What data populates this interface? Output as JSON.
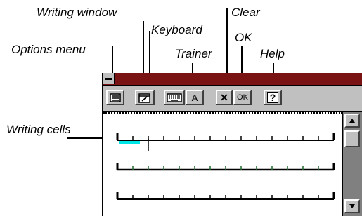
{
  "callouts": {
    "writing_window": "Writing window",
    "clear": "Clear",
    "keyboard": "Keyboard",
    "ok": "OK",
    "options_menu": "Options menu",
    "trainer": "Trainer",
    "help": "Help",
    "writing_cells": "Writing cells"
  },
  "toolbar": {
    "trainer_label": "A",
    "clear_label": "✕",
    "ok_label": "OK",
    "help_label": "?"
  },
  "icons": {
    "options_menu": "options-menu-icon",
    "writing_window": "writing-window-icon",
    "keyboard": "keyboard-icon",
    "trainer": "trainer-icon",
    "clear": "close-icon",
    "ok": "ok-icon",
    "help": "help-icon",
    "scroll_up": "arrow-up-icon",
    "scroll_down": "arrow-down-icon"
  },
  "colors": {
    "titlebar": "#7a1414",
    "window_face": "#c0c0c0",
    "selection": "#00e5e5",
    "cell_tick_active": "#1c6b2b"
  },
  "writing_rows": [
    {
      "cells": 14,
      "active": true
    },
    {
      "cells": 14,
      "active": false
    },
    {
      "cells": 14,
      "active": false
    }
  ]
}
